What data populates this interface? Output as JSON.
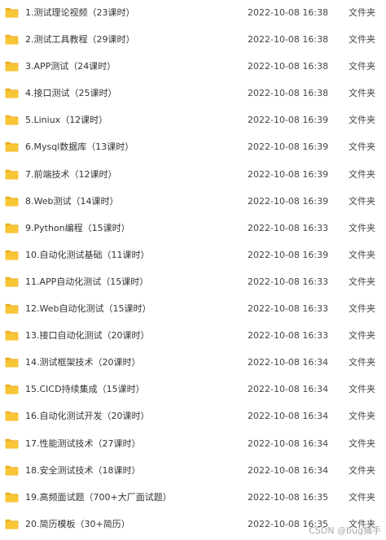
{
  "files": [
    {
      "name": "1.测试理论视频（23课时）",
      "date": "2022-10-08 16:38",
      "type": "文件夹"
    },
    {
      "name": "2.测试工具教程（29课时）",
      "date": "2022-10-08 16:38",
      "type": "文件夹"
    },
    {
      "name": "3.APP测试（24课时）",
      "date": "2022-10-08 16:38",
      "type": "文件夹"
    },
    {
      "name": "4.接口测试（25课时）",
      "date": "2022-10-08 16:38",
      "type": "文件夹"
    },
    {
      "name": "5.Liniux（12课时）",
      "date": "2022-10-08 16:39",
      "type": "文件夹"
    },
    {
      "name": "6.Mysql数据库（13课时）",
      "date": "2022-10-08 16:39",
      "type": "文件夹"
    },
    {
      "name": "7.前端技术（12课时）",
      "date": "2022-10-08 16:39",
      "type": "文件夹"
    },
    {
      "name": "8.Web测试（14课时）",
      "date": "2022-10-08 16:39",
      "type": "文件夹"
    },
    {
      "name": "9.Python编程（15课时）",
      "date": "2022-10-08 16:33",
      "type": "文件夹"
    },
    {
      "name": "10.自动化测试基础（11课时）",
      "date": "2022-10-08 16:39",
      "type": "文件夹"
    },
    {
      "name": "11.APP自动化测试（15课时）",
      "date": "2022-10-08 16:33",
      "type": "文件夹"
    },
    {
      "name": "12.Web自动化测试（15课时）",
      "date": "2022-10-08 16:33",
      "type": "文件夹"
    },
    {
      "name": "13.接口自动化测试（20课时）",
      "date": "2022-10-08 16:33",
      "type": "文件夹"
    },
    {
      "name": "14.测试框架技术（20课时）",
      "date": "2022-10-08 16:34",
      "type": "文件夹"
    },
    {
      "name": "15.CICD持续集成（15课时）",
      "date": "2022-10-08 16:34",
      "type": "文件夹"
    },
    {
      "name": "16.自动化测试开发（20课时）",
      "date": "2022-10-08 16:34",
      "type": "文件夹"
    },
    {
      "name": "17.性能测试技术（27课时）",
      "date": "2022-10-08 16:34",
      "type": "文件夹"
    },
    {
      "name": "18.安全测试技术（18课时）",
      "date": "2022-10-08 16:34",
      "type": "文件夹"
    },
    {
      "name": "19.高频面试题（700+大厂面试题）",
      "date": "2022-10-08 16:35",
      "type": "文件夹"
    },
    {
      "name": "20.简历模板（30+简历）",
      "date": "2022-10-08 16:35",
      "type": "文件夹"
    }
  ],
  "watermark": "CSDN @bug捕手",
  "colors": {
    "folder_body": "#F8C537",
    "folder_tab": "#E9AE1E",
    "text": "#333333"
  }
}
